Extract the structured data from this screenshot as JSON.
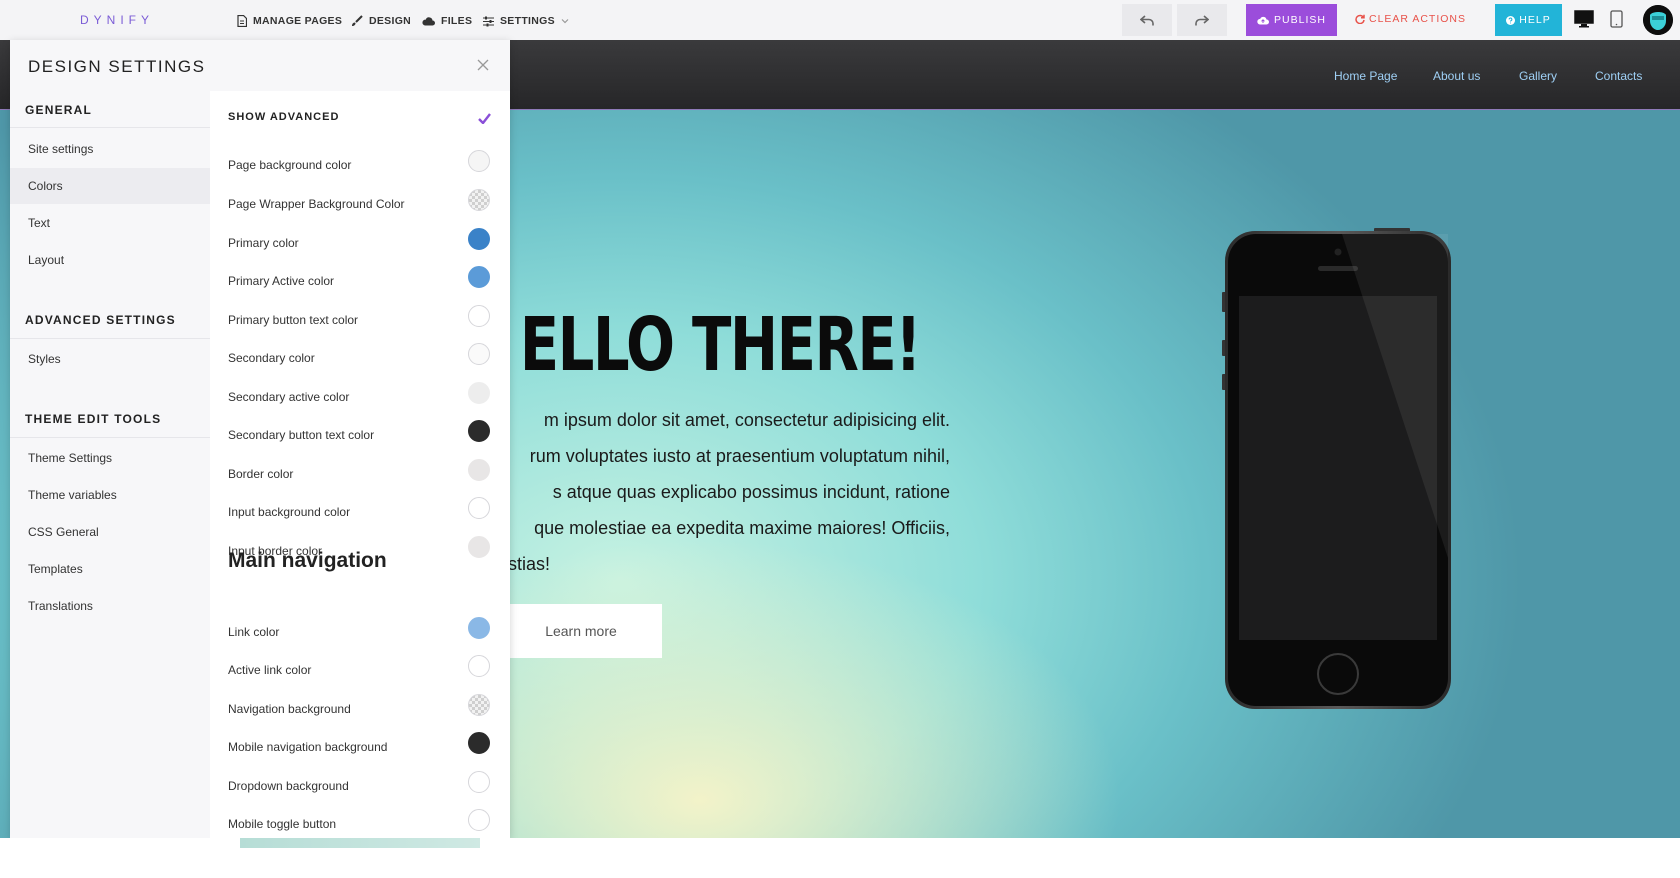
{
  "app": {
    "logo_text": "DYNIFY",
    "menu": [
      {
        "label": "MANAGE PAGES",
        "icon": "page-icon"
      },
      {
        "label": "DESIGN",
        "icon": "brush-icon"
      },
      {
        "label": "FILES",
        "icon": "cloud-icon"
      },
      {
        "label": "SETTINGS",
        "icon": "sliders-icon"
      }
    ],
    "publish_label": "PUBLISH",
    "clear_actions_label": "CLEAR ACTIONS",
    "help_label": "HELP",
    "colors": {
      "brand_purple": "#9b4ddb",
      "help_blue": "#22b4d8",
      "clear_red": "#e8524a",
      "logo_purple": "#7b5cd6"
    }
  },
  "site": {
    "nav_links": [
      "Home Page",
      "About us",
      "Gallery",
      "Contacts"
    ],
    "hero_title": "ELLO THERE!",
    "hero_lines": [
      "m ipsum dolor sit amet, consectetur adipisicing elit.",
      "rum voluptates iusto at praesentium voluptatum nihil,",
      "s atque quas explicabo possimus incidunt, ratione",
      "que molestiae ea expedita maxime maiores! Officiis,",
      "stias!"
    ],
    "cta_label": "Learn more"
  },
  "panel": {
    "title": "DESIGN SETTINGS",
    "sidebar": {
      "general_heading": "GENERAL",
      "general_items": [
        "Site settings",
        "Colors",
        "Text",
        "Layout"
      ],
      "active_item": "Colors",
      "advanced_heading": "ADVANCED SETTINGS",
      "advanced_items": [
        "Styles"
      ],
      "tools_heading": "THEME EDIT TOOLS",
      "tools_items": [
        "Theme Settings",
        "Theme variables",
        "CSS General",
        "Templates",
        "Translations"
      ]
    },
    "show_advanced_label": "SHOW ADVANCED",
    "show_advanced_checked": true,
    "colors": [
      {
        "label": "Page background color",
        "color": "#f5f5f5"
      },
      {
        "label": "Page Wrapper Background Color",
        "color": "transparent"
      },
      {
        "label": "Primary color",
        "color": "#3a82c8"
      },
      {
        "label": "Primary Active color",
        "color": "#5b9bd8"
      },
      {
        "label": "Primary button text color",
        "color": "#ffffff"
      },
      {
        "label": "Secondary color",
        "color": "#fafafa"
      },
      {
        "label": "Secondary active color",
        "color": "#ededed"
      },
      {
        "label": "Secondary button text color",
        "color": "#2b2b2b"
      },
      {
        "label": "Border color",
        "color": "#e8e6e6"
      },
      {
        "label": "Input background color",
        "color": "#ffffff"
      },
      {
        "label": "Input border color",
        "color": "#e8e6e6"
      }
    ],
    "nav_section_title": "Main navigation",
    "nav_colors": [
      {
        "label": "Link color",
        "color": "#8ab8e6"
      },
      {
        "label": "Active link color",
        "color": "#ffffff"
      },
      {
        "label": "Navigation background",
        "color": "transparent"
      },
      {
        "label": "Mobile navigation background",
        "color": "#2b2b2b"
      },
      {
        "label": "Dropdown background",
        "color": "#ffffff"
      },
      {
        "label": "Mobile toggle button",
        "color": "#ffffff"
      }
    ]
  }
}
